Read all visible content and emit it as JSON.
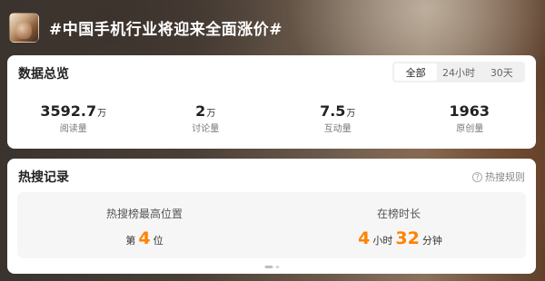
{
  "topic": {
    "title": "#中国手机行业将迎来全面涨价#"
  },
  "overview": {
    "title": "数据总览",
    "tabs": [
      {
        "label": "全部",
        "active": true
      },
      {
        "label": "24小时",
        "active": false
      },
      {
        "label": "30天",
        "active": false
      }
    ],
    "stats": [
      {
        "value": "3592.7",
        "unit": "万",
        "label": "阅读量"
      },
      {
        "value": "2",
        "unit": "万",
        "label": "讨论量"
      },
      {
        "value": "7.5",
        "unit": "万",
        "label": "互动量"
      },
      {
        "value": "1963",
        "unit": "",
        "label": "原创量"
      }
    ]
  },
  "hot_search": {
    "title": "热搜记录",
    "rule_link": "热搜规则",
    "highest": {
      "label": "热搜榜最高位置",
      "prefix": "第",
      "value": "4",
      "suffix": "位"
    },
    "duration": {
      "label": "在榜时长",
      "hours": "4",
      "hours_unit": "小时",
      "minutes": "32",
      "minutes_unit": "分钟"
    },
    "colors": {
      "accent": "#ff8200"
    }
  }
}
